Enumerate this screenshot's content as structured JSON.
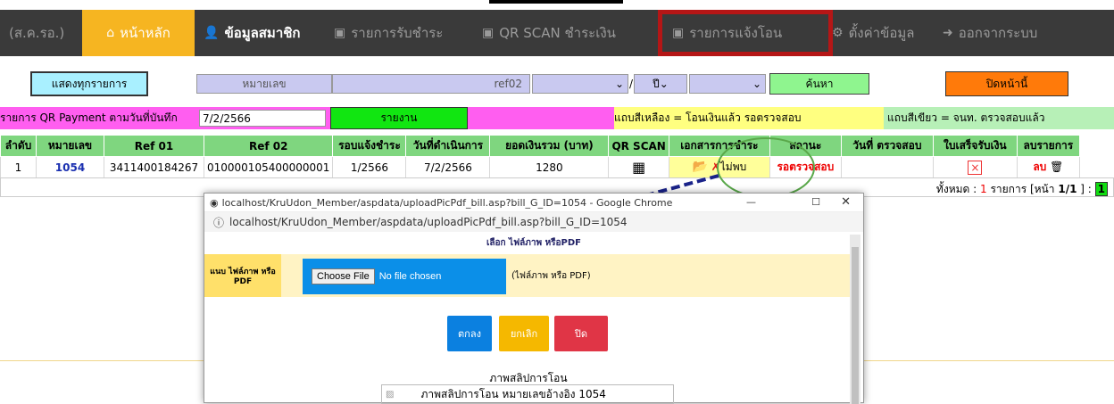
{
  "nav": {
    "brand": "(ส.ค.รอ.)",
    "home": "หน้าหลัก",
    "member": "ข้อมูลสมาชิก",
    "receipts": "รายการรับชำระ",
    "qrscan": "QR SCAN ชำระเงิน",
    "transfer_notices": "รายการแจ้งโอน",
    "settings": "ตั้งค่าข้อมูล",
    "logout": "ออกจากระบบ"
  },
  "toolbar": {
    "show_all": "แสดงทุกรายการ",
    "number_placeholder": "หมายเลข",
    "ref_value": "ref02",
    "year_label": "ปี",
    "search": "ค้นหา",
    "close_page": "ปิดหน้านี้"
  },
  "report": {
    "label": "รายการ QR Payment ตามวันที่บันทึก",
    "date": "7/2/2566",
    "report_button": "รายงาน",
    "legend_yellow": "แถบสีเหลือง = โอนเงินแล้ว รอตรวจสอบ",
    "legend_green": "แถบสีเขียว = จนท. ตรวจสอบแล้ว"
  },
  "table": {
    "headers": [
      "ลำดับ",
      "หมายเลข",
      "Ref 01",
      "Ref 02",
      "รอบแจ้งชำระ",
      "วันที่ดำเนินการ",
      "ยอดเงินรวม (บาท)",
      "QR SCAN",
      "เอกสารการชำระ",
      "สถานะ",
      "วันที่ ตรวจสอบ",
      "ใบเสร็จรับเงิน",
      "ลบรายการ"
    ],
    "rows": [
      {
        "no": "1",
        "number": "1054",
        "ref01": "3411400184267",
        "ref02": "010000105400000001",
        "round": "1/2566",
        "date": "7/2/2566",
        "amount": "1280",
        "doc_status": "ไม่พบ",
        "status": "รอตรวจสอบ",
        "checked": "",
        "delete": "ลบ"
      }
    ]
  },
  "footer": {
    "total_label": "ทั้งหมด :",
    "total": "1",
    "total_unit": "รายการ",
    "page_label": "[หน้า",
    "page": "1/1",
    "page_end": "]  :",
    "current_page": "1"
  },
  "popup": {
    "window_title": "localhost/KruUdon_Member/aspdata/uploadPicPdf_bill.asp?bill_G_ID=1054 - Google Chrome",
    "url": "localhost/KruUdon_Member/aspdata/uploadPicPdf_bill.asp?bill_G_ID=1054",
    "heading": "เลือก ไฟล์ภาพ หรือPDF",
    "attach_label": "แนบ ไฟล์ภาพ หรือ PDF",
    "choose_file": "Choose File",
    "no_file": "No file chosen",
    "file_hint": "(ไฟล์ภาพ หรือ PDF)",
    "ok": "ตกลง",
    "cancel": "ยกเลิก",
    "close": "ปิด",
    "slip_title": "ภาพสลิปการโอน",
    "slip_alt": "ภาพสลิปการโอน หมายเลขอ้างอิง 1054"
  }
}
